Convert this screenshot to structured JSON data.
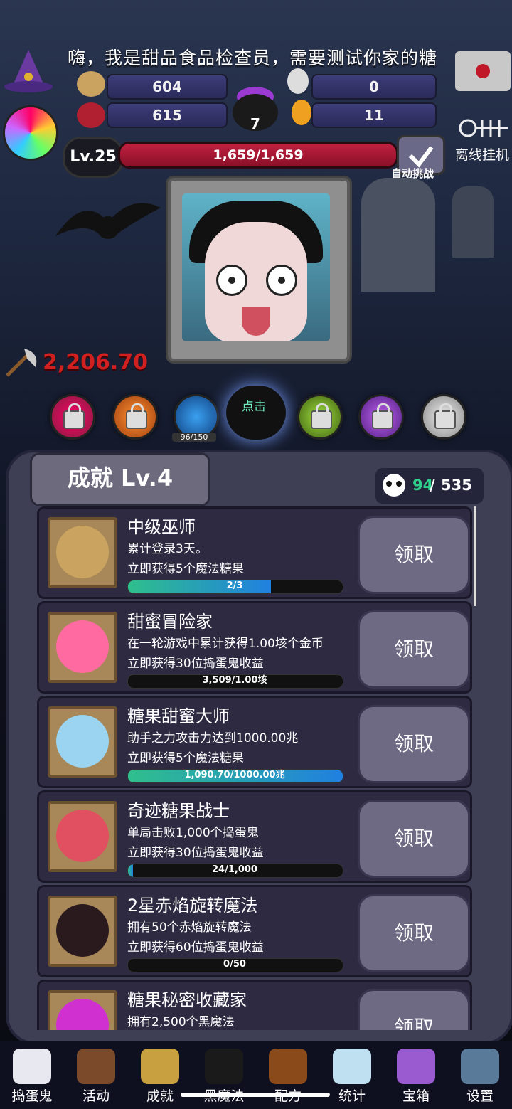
{
  "banner_text": "嗨，我是甜品食品检查员，需要测试你家的糖",
  "stats": {
    "cookies": "604",
    "skull_potions": "0",
    "candy_skulls": "615",
    "candy_corn": "11",
    "cauldron": "7"
  },
  "level": "Lv.25",
  "hp_text": "1,659/1,659",
  "hp_fraction": 1.0,
  "auto_label": "自动挑战",
  "offline_label": "离线挂机",
  "damage_text": "2,206.70",
  "orb_progress": "96/150",
  "click_label": "点击",
  "panel": {
    "title": "成就 Lv.4",
    "count_done": "94",
    "count_sep": " / ",
    "count_total": "535"
  },
  "achievements": [
    {
      "title": "中级巫师",
      "desc1": "累计登录3天。",
      "desc2": "立即获得5个魔法糖果",
      "progress": "2/3",
      "fraction": 0.667,
      "claim": "领取",
      "icon_color": "#c9a35f"
    },
    {
      "title": "甜蜜冒险家",
      "desc1": "在一轮游戏中累计获得1.00垓个金币",
      "desc2": "立即获得30位捣蛋鬼收益",
      "progress": "3,509/1.00垓",
      "fraction": 0.0,
      "claim": "领取",
      "icon_color": "#ff6aa0"
    },
    {
      "title": "糖果甜蜜大师",
      "desc1": "助手之力攻击力达到1000.00兆",
      "desc2": "立即获得5个魔法糖果",
      "progress": "1,090.70/1000.00兆",
      "fraction": 1.0,
      "claim": "领取",
      "icon_color": "#9ad4f0"
    },
    {
      "title": "奇迹糖果战士",
      "desc1": "单局击败1,000个捣蛋鬼",
      "desc2": "立即获得30位捣蛋鬼收益",
      "progress": "24/1,000",
      "fraction": 0.024,
      "claim": "领取",
      "icon_color": "#e05060"
    },
    {
      "title": "2星赤焰旋转魔法",
      "desc1": "拥有50个赤焰旋转魔法",
      "desc2": "立即获得60位捣蛋鬼收益",
      "progress": "0/50",
      "fraction": 0.0,
      "claim": "领取",
      "icon_color": "#2a1a1e"
    },
    {
      "title": "糖果秘密收藏家",
      "desc1": "拥有2,500个黑魔法",
      "desc2": "",
      "progress": "",
      "fraction": 0.0,
      "claim": "领取",
      "icon_color": "#d030d0"
    }
  ],
  "nav": [
    {
      "label": "捣蛋鬼",
      "icon": "ghost-icon",
      "color": "#e8e8f0"
    },
    {
      "label": "活动",
      "icon": "cupcake-icon",
      "color": "#7a4a2a"
    },
    {
      "label": "成就",
      "icon": "skull-trophy-icon",
      "color": "#c8a040"
    },
    {
      "label": "黑魔法",
      "icon": "black-cat-icon",
      "color": "#1a1a1a"
    },
    {
      "label": "配方",
      "icon": "spellbook-icon",
      "color": "#8a4a1a"
    },
    {
      "label": "统计",
      "icon": "crystal-ball-icon",
      "color": "#bfe0f0"
    },
    {
      "label": "宝箱",
      "icon": "gift-box-icon",
      "color": "#9a5ad0"
    },
    {
      "label": "设置",
      "icon": "gear-icon",
      "color": "#5a7a9a"
    }
  ]
}
